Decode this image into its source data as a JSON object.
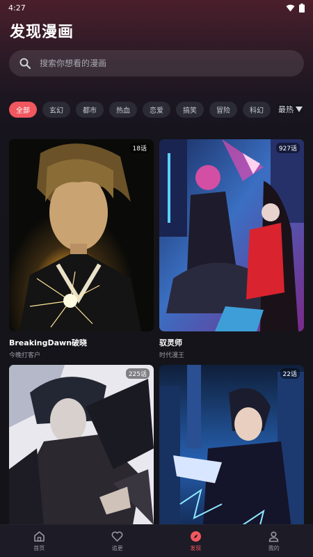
{
  "status_bar": {
    "time": "4:27",
    "wifi_icon": "wifi-icon",
    "battery_icon": "battery-icon"
  },
  "page_title": "发现漫画",
  "search": {
    "placeholder": "搜索你想看的漫画",
    "icon": "search-icon"
  },
  "categories": [
    {
      "label": "全部",
      "active": true
    },
    {
      "label": "玄幻",
      "active": false
    },
    {
      "label": "都市",
      "active": false
    },
    {
      "label": "热血",
      "active": false
    },
    {
      "label": "恋爱",
      "active": false
    },
    {
      "label": "搞笑",
      "active": false
    },
    {
      "label": "冒险",
      "active": false
    },
    {
      "label": "科幻",
      "active": false
    }
  ],
  "sort": {
    "label": "最热",
    "icon": "caret-down-icon"
  },
  "comics": [
    {
      "title": "BreakingDawn破晓",
      "author": "今晚打客户",
      "episodes": "18话"
    },
    {
      "title": "驭灵师",
      "author": "时代漫王",
      "episodes": "927话"
    },
    {
      "title": "",
      "author": "",
      "episodes": "225话"
    },
    {
      "title": "",
      "author": "",
      "episodes": "22话"
    }
  ],
  "nav": [
    {
      "label": "首页",
      "icon": "home-icon",
      "active": false
    },
    {
      "label": "追更",
      "icon": "heart-icon",
      "active": false
    },
    {
      "label": "发现",
      "icon": "compass-icon",
      "active": true
    },
    {
      "label": "我的",
      "icon": "user-icon",
      "active": false
    }
  ],
  "colors": {
    "accent": "#f0575f",
    "background": "#141318",
    "chip": "#2b2b36"
  }
}
